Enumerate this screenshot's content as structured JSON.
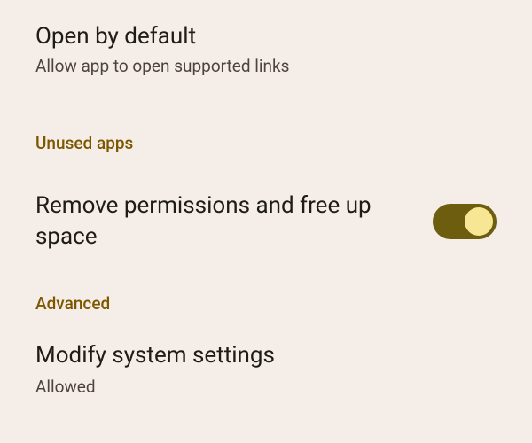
{
  "open_by_default": {
    "title": "Open by default",
    "subtitle": "Allow app to open supported links"
  },
  "sections": {
    "unused_apps": "Unused apps",
    "advanced": "Advanced"
  },
  "remove_permissions": {
    "title": "Remove permissions and free up space",
    "toggle_on": true
  },
  "modify_system": {
    "title": "Modify system settings",
    "subtitle": "Allowed"
  }
}
